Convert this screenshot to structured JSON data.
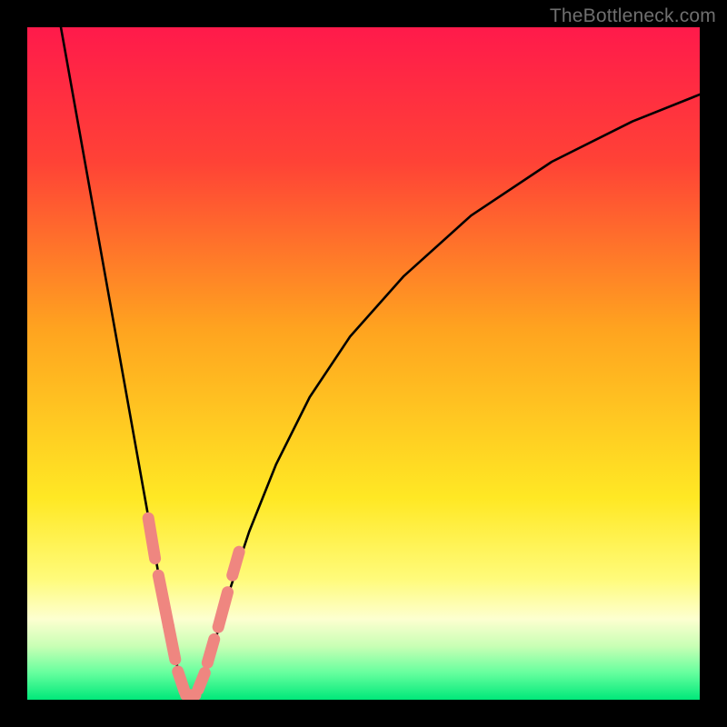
{
  "watermark": "TheBottleneck.com",
  "chart_data": {
    "type": "line",
    "title": "",
    "xlabel": "",
    "ylabel": "",
    "xlim": [
      0,
      100
    ],
    "ylim": [
      0,
      100
    ],
    "background_gradient": {
      "stops": [
        {
          "pos": 0.0,
          "color": "#ff1a4b"
        },
        {
          "pos": 0.2,
          "color": "#ff4236"
        },
        {
          "pos": 0.45,
          "color": "#ffa41f"
        },
        {
          "pos": 0.7,
          "color": "#ffe824"
        },
        {
          "pos": 0.82,
          "color": "#fffb7a"
        },
        {
          "pos": 0.88,
          "color": "#fdffd0"
        },
        {
          "pos": 0.92,
          "color": "#c9ffb5"
        },
        {
          "pos": 0.96,
          "color": "#66ff9e"
        },
        {
          "pos": 1.0,
          "color": "#00e87a"
        }
      ]
    },
    "series": [
      {
        "name": "left-arm",
        "x": [
          5,
          7.5,
          10,
          12.5,
          15,
          17.5,
          20,
          21.5,
          22.5,
          23.5,
          24
        ],
        "y": [
          100,
          86,
          72,
          58,
          44,
          30,
          16,
          9,
          4,
          1,
          0
        ]
      },
      {
        "name": "right-arm",
        "x": [
          24,
          26,
          28,
          30,
          33,
          37,
          42,
          48,
          56,
          66,
          78,
          90,
          100
        ],
        "y": [
          0,
          3,
          9,
          16,
          25,
          35,
          45,
          54,
          63,
          72,
          80,
          86,
          90
        ]
      }
    ],
    "markers": {
      "name": "highlight-segments",
      "color": "#ef8680",
      "segments": [
        {
          "x1": 18.0,
          "y1": 27,
          "x2": 19.0,
          "y2": 21
        },
        {
          "x1": 19.5,
          "y1": 18.5,
          "x2": 21.0,
          "y2": 11
        },
        {
          "x1": 21.0,
          "y1": 11,
          "x2": 22.0,
          "y2": 6
        },
        {
          "x1": 22.4,
          "y1": 4.2,
          "x2": 23.4,
          "y2": 1.2
        },
        {
          "x1": 23.6,
          "y1": 0.7,
          "x2": 25.0,
          "y2": 0.7
        },
        {
          "x1": 25.4,
          "y1": 1.5,
          "x2": 26.4,
          "y2": 4.0
        },
        {
          "x1": 26.8,
          "y1": 5.5,
          "x2": 27.8,
          "y2": 9.0
        },
        {
          "x1": 28.4,
          "y1": 10.8,
          "x2": 29.8,
          "y2": 16.0
        },
        {
          "x1": 30.5,
          "y1": 18.5,
          "x2": 31.5,
          "y2": 22.0
        }
      ]
    }
  }
}
